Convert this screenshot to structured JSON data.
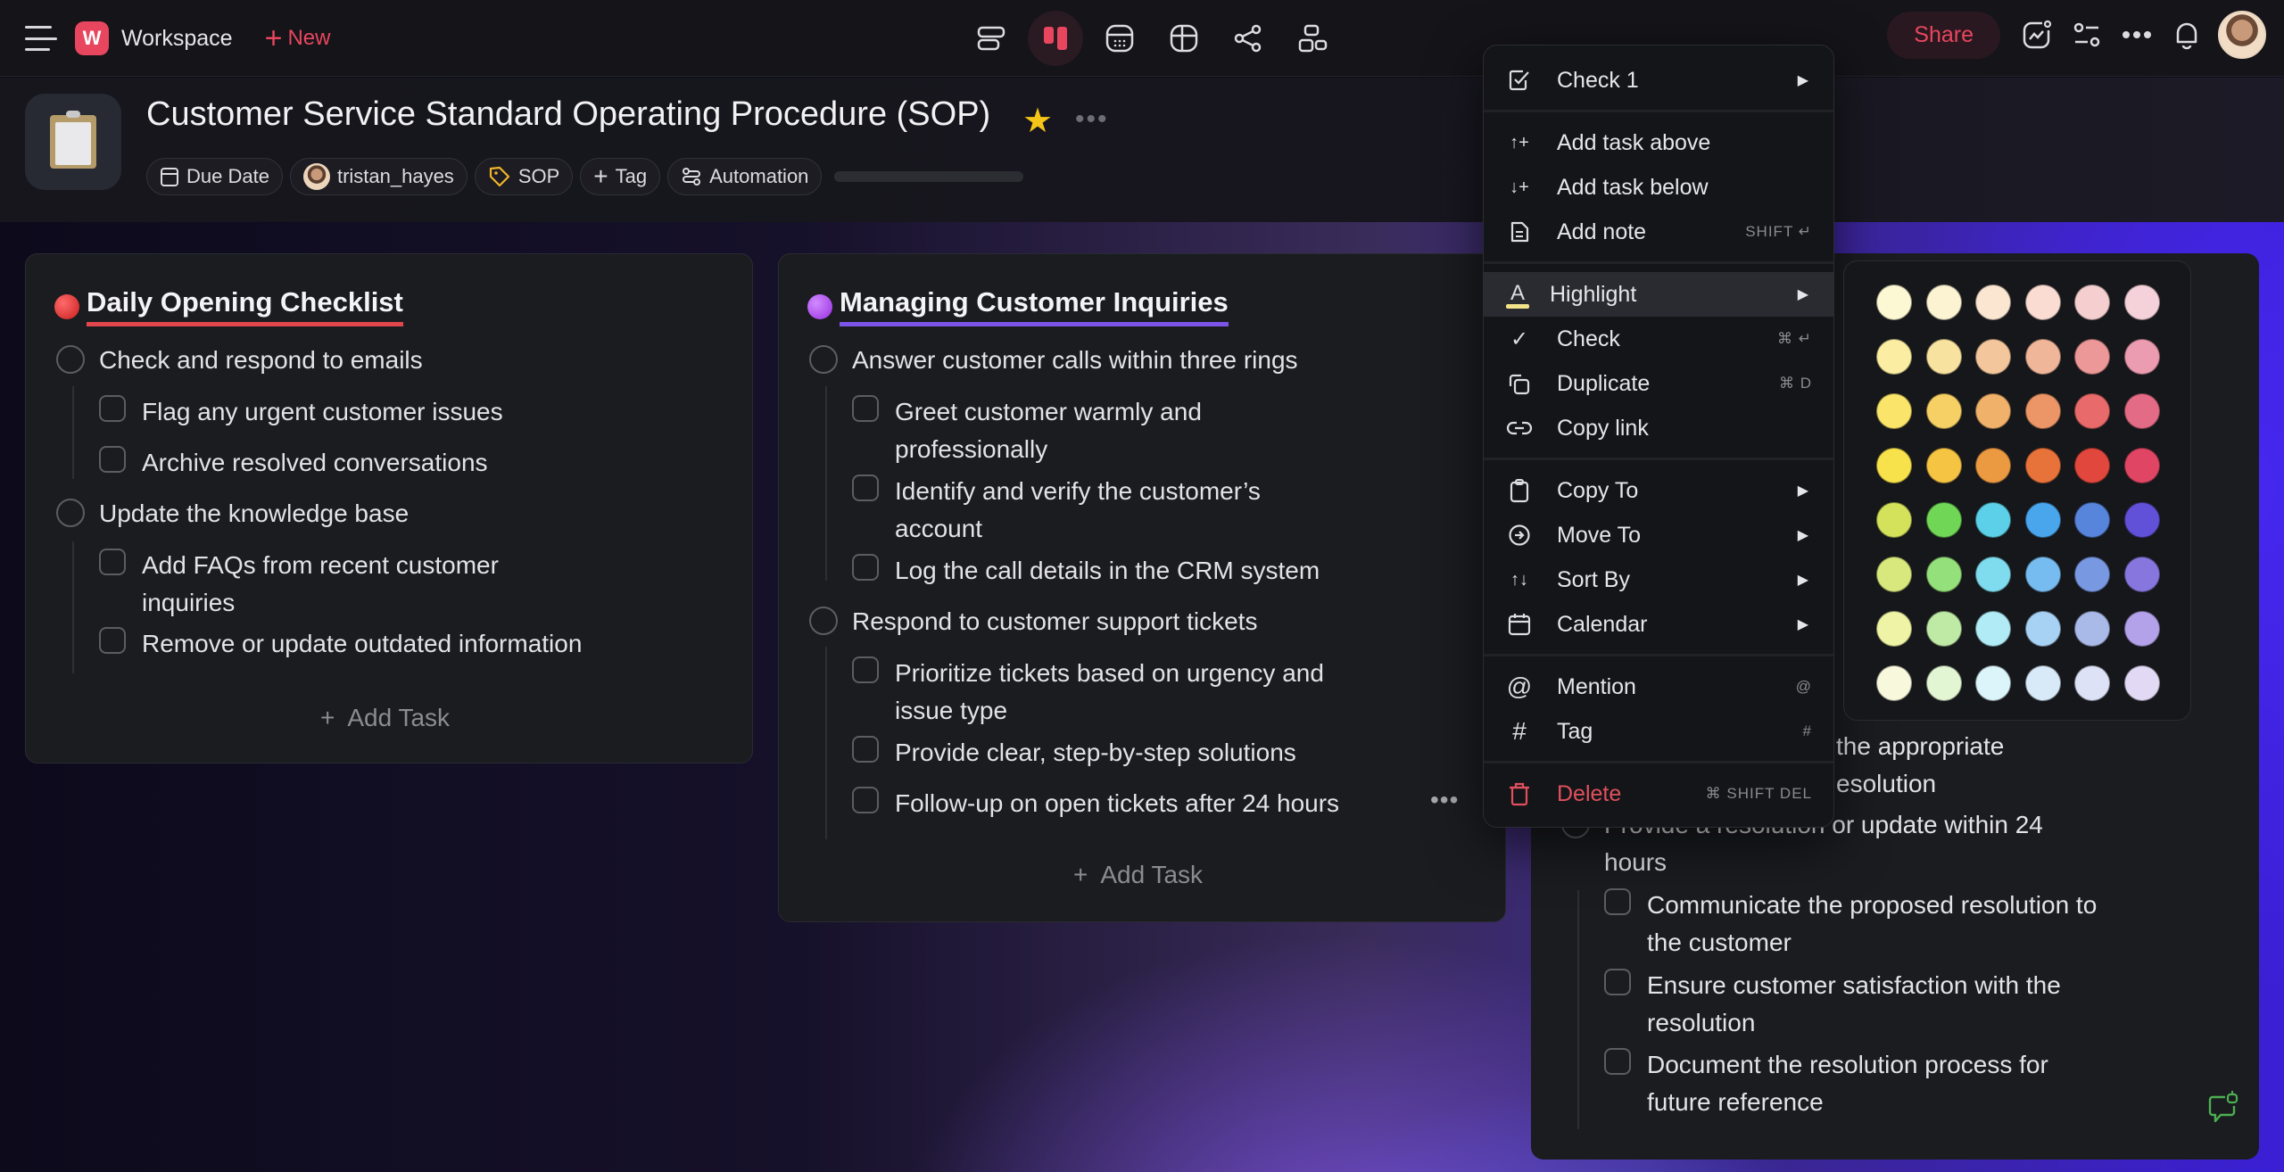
{
  "topbar": {
    "workspace_initial": "W",
    "workspace_name": "Workspace",
    "new_label": "New",
    "views": [
      {
        "name": "list-view-icon",
        "active": false
      },
      {
        "name": "board-view-icon",
        "active": true
      },
      {
        "name": "calendar-view-icon",
        "active": false
      },
      {
        "name": "table-view-icon",
        "active": false
      },
      {
        "name": "mindmap-view-icon",
        "active": false
      },
      {
        "name": "org-view-icon",
        "active": false
      }
    ],
    "share_label": "Share",
    "right_icons": [
      "analytics-icon",
      "settings-toggle-icon",
      "more-icon",
      "bell-icon"
    ]
  },
  "header": {
    "title": "Customer Service Standard Operating Procedure (SOP)",
    "starred": true,
    "chips": {
      "due_date": "Due Date",
      "assignee": "tristan_hayes",
      "tag": "SOP",
      "add_tag": "Tag",
      "automation": "Automation"
    },
    "progress": 0
  },
  "columns": [
    {
      "title": "Daily Opening Checklist",
      "color": "#e2474d",
      "tasks": [
        {
          "text": "Check and respond to emails",
          "subtasks": [
            "Flag any urgent customer issues",
            "Archive resolved conversations"
          ]
        },
        {
          "text": "Update the knowledge base",
          "subtasks": [
            "Add FAQs from recent customer inquiries",
            "Remove or update outdated information"
          ]
        }
      ],
      "add_label": "Add Task"
    },
    {
      "title": "Managing Customer Inquiries",
      "color": "#7c55e8",
      "tasks": [
        {
          "text": "Answer customer calls within three rings",
          "subtasks": [
            "Greet customer warmly and professionally",
            "Identify and verify the customer’s account",
            "Log the call details in the CRM system"
          ]
        },
        {
          "text": "Respond to customer support tickets",
          "subtasks": [
            "Prioritize tickets based on urgency and issue type",
            "Provide clear, step-by-step solutions",
            "Follow-up on open tickets after 24 hours"
          ]
        }
      ],
      "add_label": "Add Task"
    },
    {
      "visible_fragments": [
        "the appropriate",
        "esolution"
      ],
      "tasks": [
        {
          "text": "Provide a resolution or update within 24 hours",
          "subtasks": [
            "Communicate the proposed resolution to the customer",
            "Ensure customer satisfaction with the resolution",
            "Document the resolution process for future reference"
          ]
        }
      ]
    }
  ],
  "context_menu": {
    "items": [
      {
        "label": "Check 1",
        "icon": "checkbox-icon",
        "submenu": true
      },
      {
        "label": "Add task above",
        "icon": "add-above-icon"
      },
      {
        "label": "Add task below",
        "icon": "add-below-icon"
      },
      {
        "label": "Add note",
        "icon": "note-icon",
        "shortcut": "SHIFT ↵"
      },
      {
        "label": "Highlight",
        "icon": "highlight-icon",
        "submenu": true,
        "active": true
      },
      {
        "label": "Check",
        "icon": "check-icon",
        "shortcut": "⌘ ↵"
      },
      {
        "label": "Duplicate",
        "icon": "duplicate-icon",
        "shortcut": "⌘ D"
      },
      {
        "label": "Copy link",
        "icon": "link-icon"
      },
      {
        "label": "Copy To",
        "icon": "clipboard-icon",
        "submenu": true
      },
      {
        "label": "Move To",
        "icon": "move-icon",
        "submenu": true
      },
      {
        "label": "Sort By",
        "icon": "sort-icon",
        "submenu": true
      },
      {
        "label": "Calendar",
        "icon": "calendar-icon",
        "submenu": true
      },
      {
        "label": "Mention",
        "icon": "at-icon",
        "shortcut": "@"
      },
      {
        "label": "Tag",
        "icon": "hash-icon",
        "shortcut": "#"
      },
      {
        "label": "Delete",
        "icon": "trash-icon",
        "shortcut": "⌘ SHIFT DEL"
      }
    ]
  },
  "highlight_palette": [
    [
      "#fdf8d4",
      "#fbf3d2",
      "#fbe6d2",
      "#fadcd2",
      "#f5cfd0",
      "#f5d2da"
    ],
    [
      "#fbeea2",
      "#f8e2a0",
      "#f3c79b",
      "#efb699",
      "#ec9898",
      "#eb9cb0"
    ],
    [
      "#fae46a",
      "#f6d064",
      "#f0b16a",
      "#ec9566",
      "#e86a6a",
      "#e46b86"
    ],
    [
      "#f8e24c",
      "#f6c443",
      "#eb9a42",
      "#e8733a",
      "#e1473c",
      "#e04664"
    ],
    [
      "#d3e25a",
      "#6fd656",
      "#5cd0e8",
      "#4aa6ec",
      "#5785dc",
      "#6150d8"
    ],
    [
      "#d8e87c",
      "#94e07a",
      "#7fdcee",
      "#77bcf0",
      "#7898e2",
      "#8676de"
    ],
    [
      "#eef3a6",
      "#bfeaa6",
      "#b0ebf6",
      "#a8d2f4",
      "#a9bae8",
      "#b3a2ea"
    ],
    [
      "#f8f8dc",
      "#e2f6d4",
      "#dcf5fa",
      "#d8eaf8",
      "#dde2f6",
      "#e2daf4"
    ]
  ]
}
